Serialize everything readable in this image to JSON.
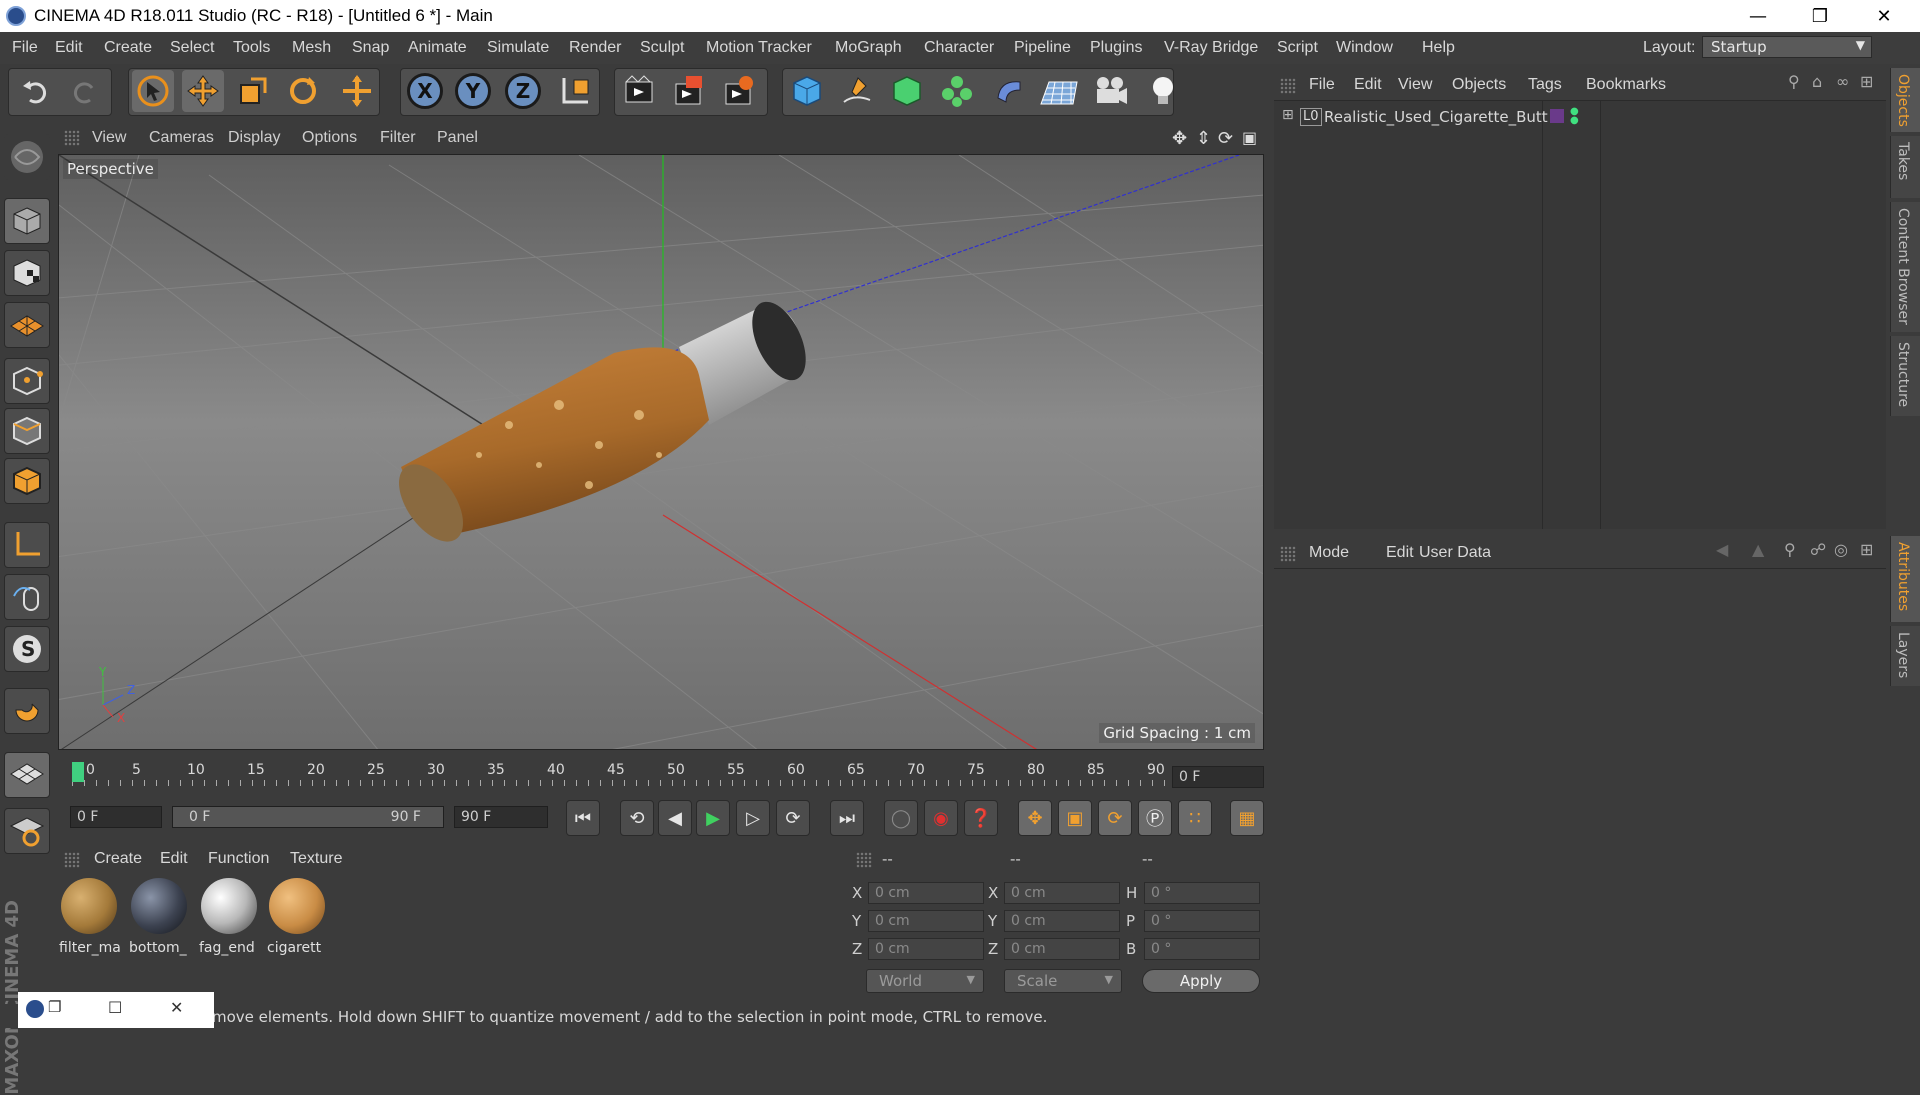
{
  "window": {
    "title": "CINEMA 4D R18.011 Studio (RC - R18) - [Untitled 6 *] - Main"
  },
  "menu": [
    "File",
    "Edit",
    "Create",
    "Select",
    "Tools",
    "Mesh",
    "Snap",
    "Animate",
    "Simulate",
    "Render",
    "Sculpt",
    "Motion Tracker",
    "MoGraph",
    "Character",
    "Pipeline",
    "Plugins",
    "V-Ray Bridge",
    "Script",
    "Window",
    "Help"
  ],
  "layout": {
    "label": "Layout:",
    "value": "Startup"
  },
  "toolbar_axes": [
    "X",
    "Y",
    "Z"
  ],
  "viewport": {
    "menu": [
      "View",
      "Cameras",
      "Display",
      "Options",
      "Filter",
      "Panel"
    ],
    "camera_label": "Perspective",
    "grid_spacing": "Grid Spacing : 1 cm",
    "axis_gizmo": [
      "Y",
      "Z",
      "X"
    ]
  },
  "timeline": {
    "ticks": [
      "0",
      "5",
      "10",
      "15",
      "20",
      "25",
      "30",
      "35",
      "40",
      "45",
      "50",
      "55",
      "60",
      "65",
      "70",
      "75",
      "80",
      "85",
      "90"
    ],
    "current_frame": "0 F"
  },
  "transport": {
    "start": "0 F",
    "range_start": "0 F",
    "range_end": "90 F",
    "end": "90 F"
  },
  "materials": {
    "menu": [
      "Create",
      "Edit",
      "Function",
      "Texture"
    ],
    "items": [
      {
        "name": "filter_ma",
        "color": "#a47a3a"
      },
      {
        "name": "bottom_",
        "color": "#3c4250"
      },
      {
        "name": "fag_end",
        "color": "#b8b8b8"
      },
      {
        "name": "cigarett",
        "color": "#c98c45"
      }
    ]
  },
  "coordinates": {
    "headers": [
      "--",
      "--",
      "--"
    ],
    "rows": [
      {
        "l1": "X",
        "v1": "0 cm",
        "l2": "X",
        "v2": "0 cm",
        "l3": "H",
        "v3": "0 °"
      },
      {
        "l1": "Y",
        "v1": "0 cm",
        "l2": "Y",
        "v2": "0 cm",
        "l3": "P",
        "v3": "0 °"
      },
      {
        "l1": "Z",
        "v1": "0 cm",
        "l2": "Z",
        "v2": "0 cm",
        "l3": "B",
        "v3": "0 °"
      }
    ],
    "mode": "World",
    "type": "Scale",
    "apply": "Apply"
  },
  "status": "move elements. Hold down SHIFT to quantize movement / add to the selection in point mode, CTRL to remove.",
  "objects": {
    "menu": [
      "File",
      "Edit",
      "View",
      "Objects",
      "Tags",
      "Bookmarks"
    ],
    "items": [
      {
        "name": "Realistic_Used_Cigarette_Butt",
        "layer_flag": "L0"
      }
    ]
  },
  "attributes": {
    "menu": [
      "Mode",
      "Edit",
      "User Data"
    ]
  },
  "right_tabs": [
    "Objects",
    "Takes",
    "Content Browser",
    "Structure",
    "Attributes",
    "Layers"
  ],
  "branding": "MAXON CINEMA 4D"
}
